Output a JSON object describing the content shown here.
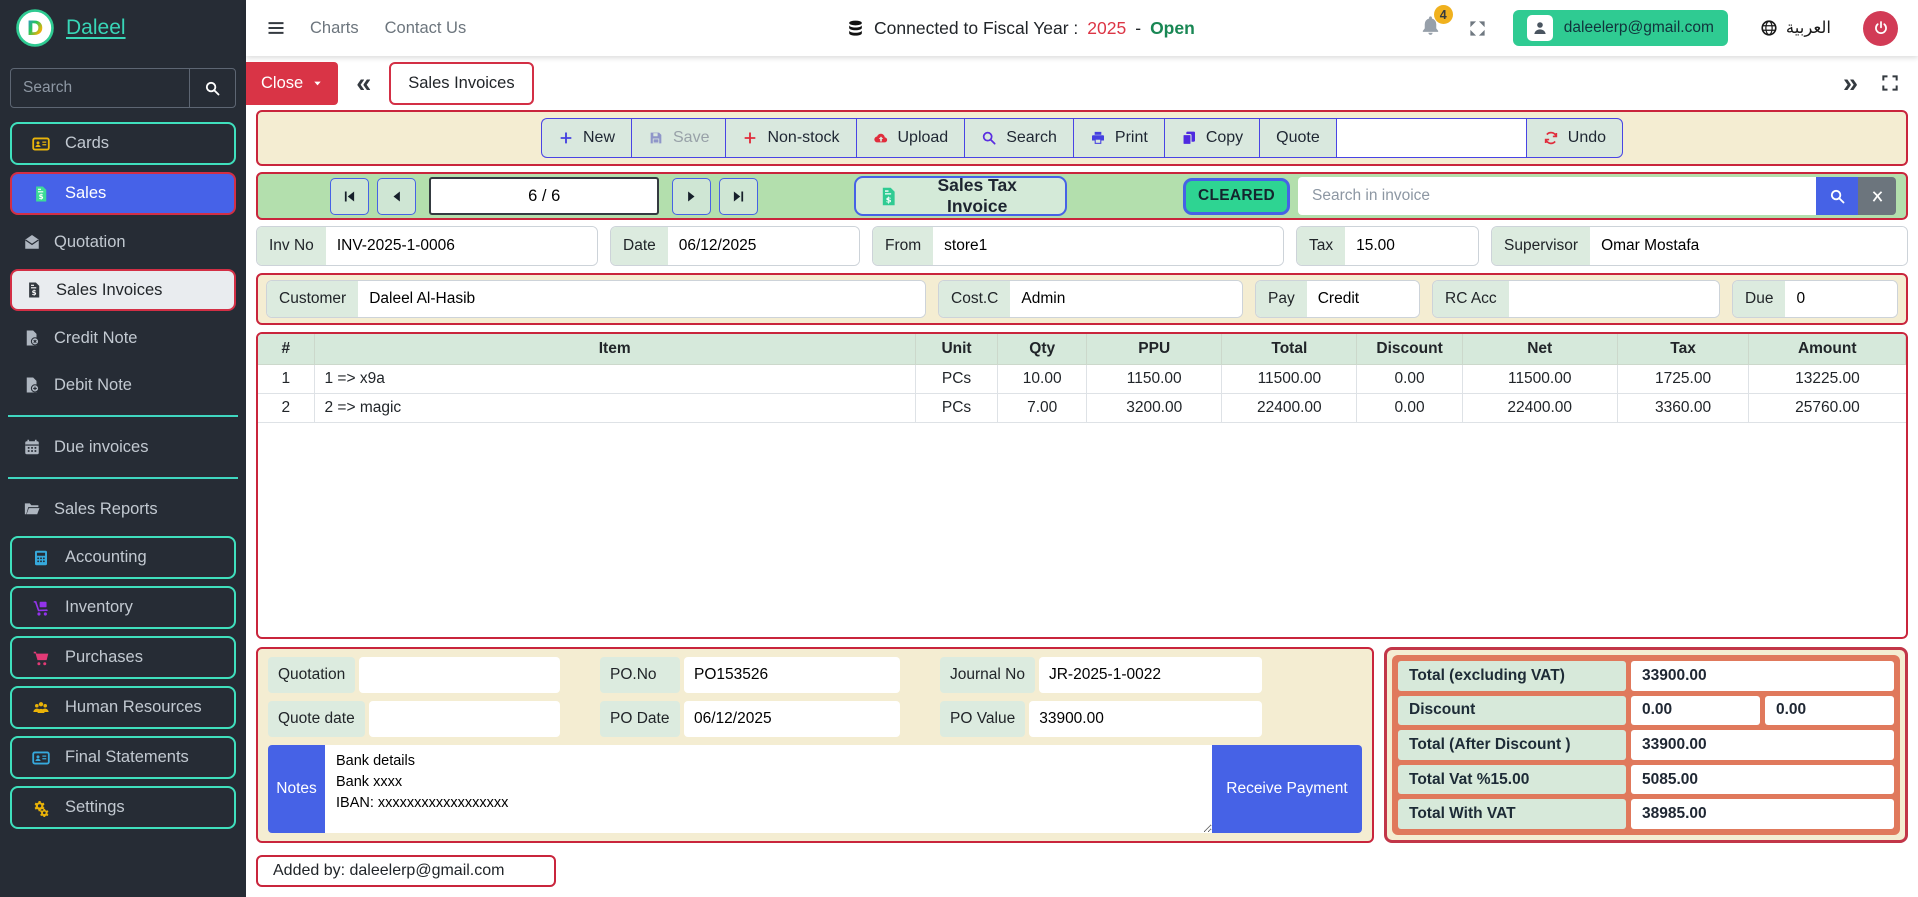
{
  "colors": {
    "brand_teal": "#3fd7c0",
    "brand_green": "#2fcb92",
    "primary_blue": "#4662e6",
    "danger_red": "#d32f45",
    "toolbar_bg": "#f4edd2",
    "navrow_bg": "#b3dfad",
    "table_header_bg": "#d6e9db",
    "label_bg": "#dcebdf",
    "totals_panel_bg": "#e0795c",
    "status_cleared_bg": "#2ed492",
    "badge_yellow": "#f0b11e",
    "sidebar_bg": "#262c35",
    "fiscal_year_red": "#dc3545",
    "fiscal_open_green": "#198754"
  },
  "topbar": {
    "brand": "Daleel",
    "menu": [
      "Charts",
      "Contact Us"
    ],
    "fiscal": {
      "prefix": "Connected to Fiscal Year :",
      "year": "2025",
      "separator": "-",
      "status": "Open"
    },
    "notifications_count": "4",
    "account_email": "daleelerp@gmail.com",
    "language": "العربية"
  },
  "sidebar": {
    "search_placeholder": "Search",
    "groups": [
      {
        "items": [
          {
            "key": "cards",
            "label": "Cards",
            "icon": "id-card-icon",
            "icon_color": "#e8b40b",
            "style": "teal-outline"
          },
          {
            "key": "sales",
            "label": "Sales",
            "icon": "invoice-icon",
            "icon_color": "#3ddc97",
            "style": "active-blue"
          },
          {
            "key": "quotation",
            "label": "Quotation",
            "icon": "envelope-icon",
            "icon_color": "#aeb6c0",
            "style": "plain"
          },
          {
            "key": "sales-invoices",
            "label": "Sales Invoices",
            "icon": "invoice-icon",
            "icon_color": "#343a40",
            "style": "active-light"
          },
          {
            "key": "credit-note",
            "label": "Credit Note",
            "icon": "file-x-icon",
            "icon_color": "#aeb6c0",
            "style": "plain"
          },
          {
            "key": "debit-note",
            "label": "Debit Note",
            "icon": "file-plus-icon",
            "icon_color": "#aeb6c0",
            "style": "plain"
          }
        ]
      },
      {
        "items": [
          {
            "key": "due-invoices",
            "label": "Due invoices",
            "icon": "calendar-icon",
            "icon_color": "#aeb6c0",
            "style": "plain"
          }
        ]
      },
      {
        "items": [
          {
            "key": "sales-reports",
            "label": "Sales Reports",
            "icon": "folder-icon",
            "icon_color": "#aeb6c0",
            "style": "plain"
          },
          {
            "key": "accounting",
            "label": "Accounting",
            "icon": "calculator-icon",
            "icon_color": "#36a9dc",
            "style": "teal-outline"
          },
          {
            "key": "inventory",
            "label": "Inventory",
            "icon": "dolly-icon",
            "icon_color": "#9333ea",
            "style": "teal-outline"
          },
          {
            "key": "purchases",
            "label": "Purchases",
            "icon": "cart-icon",
            "icon_color": "#e23a76",
            "style": "teal-outline"
          },
          {
            "key": "human-resources",
            "label": "Human Resources",
            "icon": "users-icon",
            "icon_color": "#eab308",
            "style": "teal-outline"
          },
          {
            "key": "final-statements",
            "label": "Final Statements",
            "icon": "id-card-icon",
            "icon_color": "#36a9dc",
            "style": "teal-outline"
          },
          {
            "key": "settings",
            "label": "Settings",
            "icon": "gears-icon",
            "icon_color": "#eab308",
            "style": "teal-outline"
          }
        ]
      }
    ]
  },
  "tabbar": {
    "close_label": "Close",
    "active_tab": "Sales Invoices"
  },
  "toolbar": {
    "buttons": [
      {
        "key": "new",
        "label": "New",
        "icon": "plus-icon",
        "icon_color": "#4540e0"
      },
      {
        "key": "save",
        "label": "Save",
        "icon": "save-icon",
        "icon_color": "#8f96c9",
        "state": "disabled"
      },
      {
        "key": "non-stock",
        "label": "Non-stock",
        "icon": "plus-icon",
        "icon_color": "#e02d3c"
      },
      {
        "key": "upload",
        "label": "Upload",
        "icon": "cloud-upload-icon",
        "icon_color": "#e02d3c"
      },
      {
        "key": "search",
        "label": "Search",
        "icon": "search-icon",
        "icon_color": "#5a2de0"
      },
      {
        "key": "print",
        "label": "Print",
        "icon": "printer-icon",
        "icon_color": "#4540e0"
      },
      {
        "key": "copy",
        "label": "Copy",
        "icon": "copy-icon",
        "icon_color": "#4f2ae0"
      },
      {
        "key": "quote",
        "label": "Quote"
      }
    ],
    "input_value": "",
    "undo_label": "Undo",
    "undo_icon": "undo-icon",
    "undo_icon_color": "#e02d3c"
  },
  "record_nav": {
    "position": "6 / 6",
    "doc_type_label": "Sales Tax Invoice",
    "status": "CLEARED",
    "search_placeholder": "Search in invoice"
  },
  "invoice_header": {
    "fields_row1": [
      {
        "key": "inv_no",
        "label": "Inv No",
        "value": "INV-2025-1-0006"
      },
      {
        "key": "date",
        "label": "Date",
        "value": "06/12/2025"
      },
      {
        "key": "from",
        "label": "From",
        "value": "store1"
      },
      {
        "key": "tax",
        "label": "Tax",
        "value": "15.00"
      },
      {
        "key": "supervisor",
        "label": "Supervisor",
        "value": "Omar Mostafa"
      }
    ],
    "fields_row2": [
      {
        "key": "customer",
        "label": "Customer",
        "value": "Daleel Al-Hasib"
      },
      {
        "key": "cost_c",
        "label": "Cost.C",
        "value": "Admin"
      },
      {
        "key": "pay",
        "label": "Pay",
        "value": "Credit"
      },
      {
        "key": "rc_acc",
        "label": "RC Acc",
        "value": ""
      },
      {
        "key": "due",
        "label": "Due",
        "value": "0"
      }
    ]
  },
  "items_table": {
    "columns": [
      "#",
      "Item",
      "Unit",
      "Qty",
      "PPU",
      "Total",
      "Discount",
      "Net",
      "Tax",
      "Amount"
    ],
    "rows": [
      [
        "1",
        "1 => x9a",
        "PCs",
        "10.00",
        "1150.00",
        "11500.00",
        "0.00",
        "11500.00",
        "1725.00",
        "13225.00"
      ],
      [
        "2",
        "2 => magic",
        "PCs",
        "7.00",
        "3200.00",
        "22400.00",
        "0.00",
        "22400.00",
        "3360.00",
        "25760.00"
      ]
    ]
  },
  "footer": {
    "fields": [
      {
        "key": "quotation",
        "label": "Quotation",
        "value": ""
      },
      {
        "key": "po_no",
        "label": "PO.No",
        "value": "PO153526"
      },
      {
        "key": "journal_no",
        "label": "Journal No",
        "value": "JR-2025-1-0022"
      },
      {
        "key": "quote_date",
        "label": "Quote date",
        "value": ""
      },
      {
        "key": "po_date",
        "label": "PO Date",
        "value": "06/12/2025"
      },
      {
        "key": "po_value",
        "label": "PO Value",
        "value": "33900.00"
      }
    ],
    "notes": {
      "label": "Notes",
      "value": "Bank details\nBank xxxx\nIBAN: xxxxxxxxxxxxxxxxxx"
    },
    "receive_payment_label": "Receive Payment",
    "added_by": "Added by: daleelerp@gmail.com"
  },
  "totals": {
    "rows": [
      {
        "label": "Total (excluding VAT)",
        "values": [
          "33900.00"
        ]
      },
      {
        "label": "Discount",
        "values": [
          "0.00",
          "0.00"
        ]
      },
      {
        "label": "Total (After Discount )",
        "values": [
          "33900.00"
        ]
      },
      {
        "label": "Total Vat  %15.00",
        "values": [
          "5085.00"
        ]
      },
      {
        "label": "Total With VAT",
        "values": [
          "38985.00"
        ]
      }
    ]
  }
}
